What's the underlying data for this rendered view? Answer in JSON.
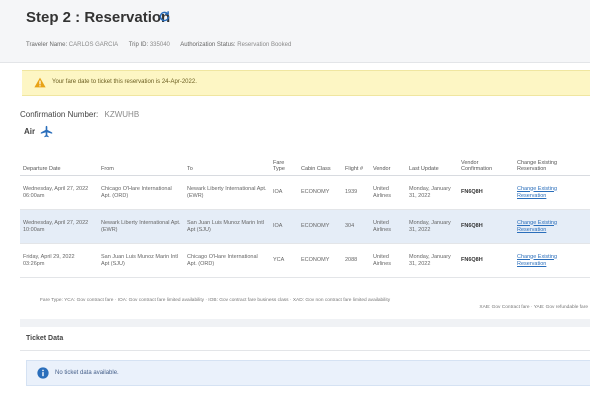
{
  "header": {
    "step_title": "Step 2 : Reservation",
    "traveler_name_label": "Traveler Name:",
    "traveler_name": "CARLOS GARCIA",
    "trip_id_label": "Trip ID:",
    "trip_id": "335040",
    "auth_status_label": "Authorization Status:",
    "auth_status": "Reservation Booked"
  },
  "warning": {
    "text": "Your fare date to ticket this reservation is 24-Apr-2022."
  },
  "confirmation": {
    "label": "Confirmation Number:",
    "value": "KZWUHB"
  },
  "air_section": {
    "label": "Air"
  },
  "flights_table": {
    "headers": {
      "departure_date": "Departure Date",
      "from": "From",
      "to": "To",
      "fare_type": "Fare Type",
      "cabin_class": "Cabin Class",
      "flight_number": "Flight #",
      "vendor": "Vendor",
      "last_update": "Last Update",
      "vendor_confirmation": "Vendor Confirmation",
      "change_existing": "Change Existing Reservation"
    },
    "rows": [
      {
        "departure_date": "Wednesday, April 27, 2022 06:00am",
        "from": "Chicago O'Hare International Apt. (ORD)",
        "to": "Newark Liberty International Apt. (EWR)",
        "fare_type": "IOA",
        "cabin_class": "ECONOMY",
        "flight_number": "1939",
        "vendor": "United Airlines",
        "last_update": "Monday, January 31, 2022",
        "vendor_confirmation": "FN6Q8H",
        "change_link": "Change Existing Reservation"
      },
      {
        "departure_date": "Wednesday, April 27, 2022 10:00am",
        "from": "Newark Liberty International Apt. (EWR)",
        "to": "San Juan Luis Munoz Marin Intl Apt (SJU)",
        "fare_type": "IOA",
        "cabin_class": "ECONOMY",
        "flight_number": "304",
        "vendor": "United Airlines",
        "last_update": "Monday, January 31, 2022",
        "vendor_confirmation": "FN6Q8H",
        "change_link": "Change Existing Reservation"
      },
      {
        "departure_date": "Friday, April 29, 2022 03:26pm",
        "from": "San Juan Luis Munoz Marin Intl Apt (SJU)",
        "to": "Chicago O'Hare International Apt. (ORD)",
        "fare_type": "YCA",
        "cabin_class": "ECONOMY",
        "flight_number": "2088",
        "vendor": "United Airlines",
        "last_update": "Monday, January 31, 2022",
        "vendor_confirmation": "FN6Q8H",
        "change_link": "Change Existing Reservation"
      }
    ]
  },
  "fare_legend": {
    "line1": "Fare Type: YCA: Gov contract fare · IOA: Gov contract fare limited availability · IOB: Gov contract fare business class · XAD: Gov non contract fare limited availability",
    "line2": "XAB: Gov Contract fare · YAB: Gov refundable fare"
  },
  "ticket_section": {
    "title": "Ticket Data",
    "info_text": "No ticket data available."
  },
  "colors": {
    "link": "#2a6ebb",
    "warning_bg": "#fdf6c4",
    "selected_row": "#e5edf7",
    "info_bg": "#eaf1fb"
  }
}
